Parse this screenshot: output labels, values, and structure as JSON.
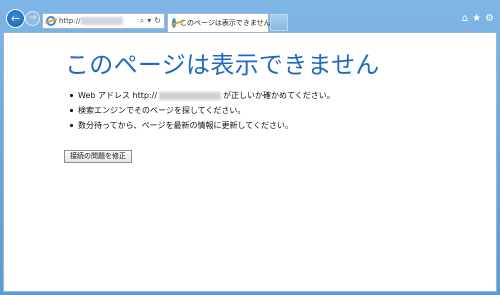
{
  "browser": {
    "back_icon": "←",
    "forward_icon": "→",
    "address": {
      "url_prefix": "http://",
      "search_icon": "⌕",
      "dropdown_icon": "▾",
      "refresh_icon": "↻"
    },
    "tab": {
      "title": "このページは表示できません",
      "close_icon": "✕"
    },
    "home_icon": "⌂",
    "favorites_icon": "★",
    "settings_icon": "⚙"
  },
  "page": {
    "heading": "このページは表示できません",
    "bullets": {
      "b1_prefix": "Web アドレス http://",
      "b1_suffix": "が正しいか確かめてください。",
      "b2": "検索エンジンでそのページを探してください。",
      "b3": "数分待ってから、ページを最新の情報に更新してください。"
    },
    "fix_button": "接続の問題を修正"
  }
}
